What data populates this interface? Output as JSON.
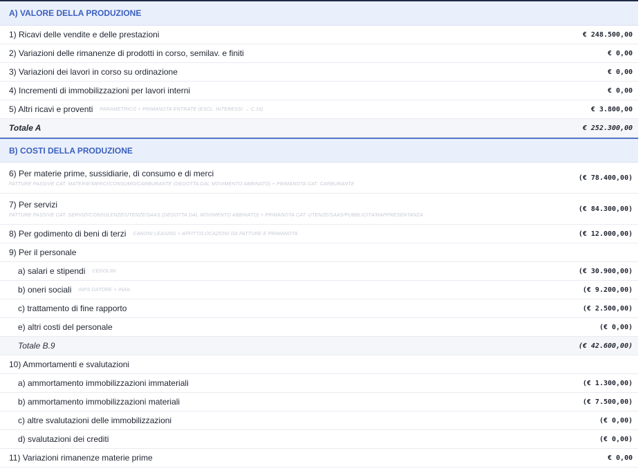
{
  "sectionA": {
    "title": "A) VALORE DELLA PRODUZIONE",
    "rows": [
      {
        "label": "1) Ricavi delle vendite e delle prestazioni",
        "value": "€ 248.500,00"
      },
      {
        "label": "2) Variazioni delle rimanenze di prodotti in corso, semilav. e finiti",
        "value": "€ 0,00"
      },
      {
        "label": "3) Variazioni dei lavori in corso su ordinazione",
        "value": "€ 0,00"
      },
      {
        "label": "4) Incrementi di immobilizzazioni per lavori interni",
        "value": "€ 0,00"
      },
      {
        "label": "5) Altri ricavi e proventi",
        "hint": "PARAMETRICO + PRIMANOTA ENTRATE (ESCL. INTERESSI → C.16)",
        "value": "€ 3.800,00"
      }
    ],
    "total": {
      "label": "Totale A",
      "value": "€ 252.300,00"
    }
  },
  "sectionB": {
    "title": "B) COSTI DELLA PRODUZIONE",
    "r6": {
      "label": "6) Per materie prime, sussidiarie, di consumo e di merci",
      "note": "FATTURE PASSIVE CAT. MATERIE/MERCI/CONSUMO/CARBURANTE (DEDOTTA DAL MOVIMENTO ABBINATO) + PRIMANOTA CAT. CARBURANTE",
      "value": "(€ 78.400,00)"
    },
    "r7": {
      "label": "7) Per servizi",
      "note": "FATTURE PASSIVE CAT. SERVIZI/CONSULENZE/UTENZE/SAAS (DEDOTTA DAL MOVIMENTO ABBINATO) + PRIMANOTA CAT. UTENZE/SAAS/PUBBLICITÀ/RAPPRESENTANZA",
      "value": "(€ 84.300,00)"
    },
    "r8": {
      "label": "8) Per godimento di beni di terzi",
      "hint": "CANONI LEASING + AFFITTI/LOCAZIONI DA FATTURE E PRIMANOTA",
      "value": "(€ 12.000,00)"
    },
    "r9": {
      "label": "9) Per il personale"
    },
    "r9a": {
      "label": "a) salari e stipendi",
      "hint": "CEDOLINI",
      "value": "(€ 30.900,00)"
    },
    "r9b": {
      "label": "b) oneri sociali",
      "hint": "INPS DATORE + INAIL",
      "value": "(€ 9.200,00)"
    },
    "r9c": {
      "label": "c) trattamento di fine rapporto",
      "value": "(€ 2.500,00)"
    },
    "r9e": {
      "label": "e) altri costi del personale",
      "value": "(€ 0,00)"
    },
    "r9tot": {
      "label": "Totale B.9",
      "value": "(€ 42.600,00)"
    },
    "r10": {
      "label": "10) Ammortamenti e svalutazioni"
    },
    "r10a": {
      "label": "a) ammortamento immobilizzazioni immateriali",
      "value": "(€ 1.300,00)"
    },
    "r10b": {
      "label": "b) ammortamento immobilizzazioni materiali",
      "value": "(€ 7.500,00)"
    },
    "r10c": {
      "label": "c) altre svalutazioni delle immobilizzazioni",
      "value": "(€ 0,00)"
    },
    "r10d": {
      "label": "d) svalutazioni dei crediti",
      "value": "(€ 0,00)"
    },
    "r11": {
      "label": "11) Variazioni rimanenze materie prime",
      "value": "€ 0,00"
    }
  }
}
